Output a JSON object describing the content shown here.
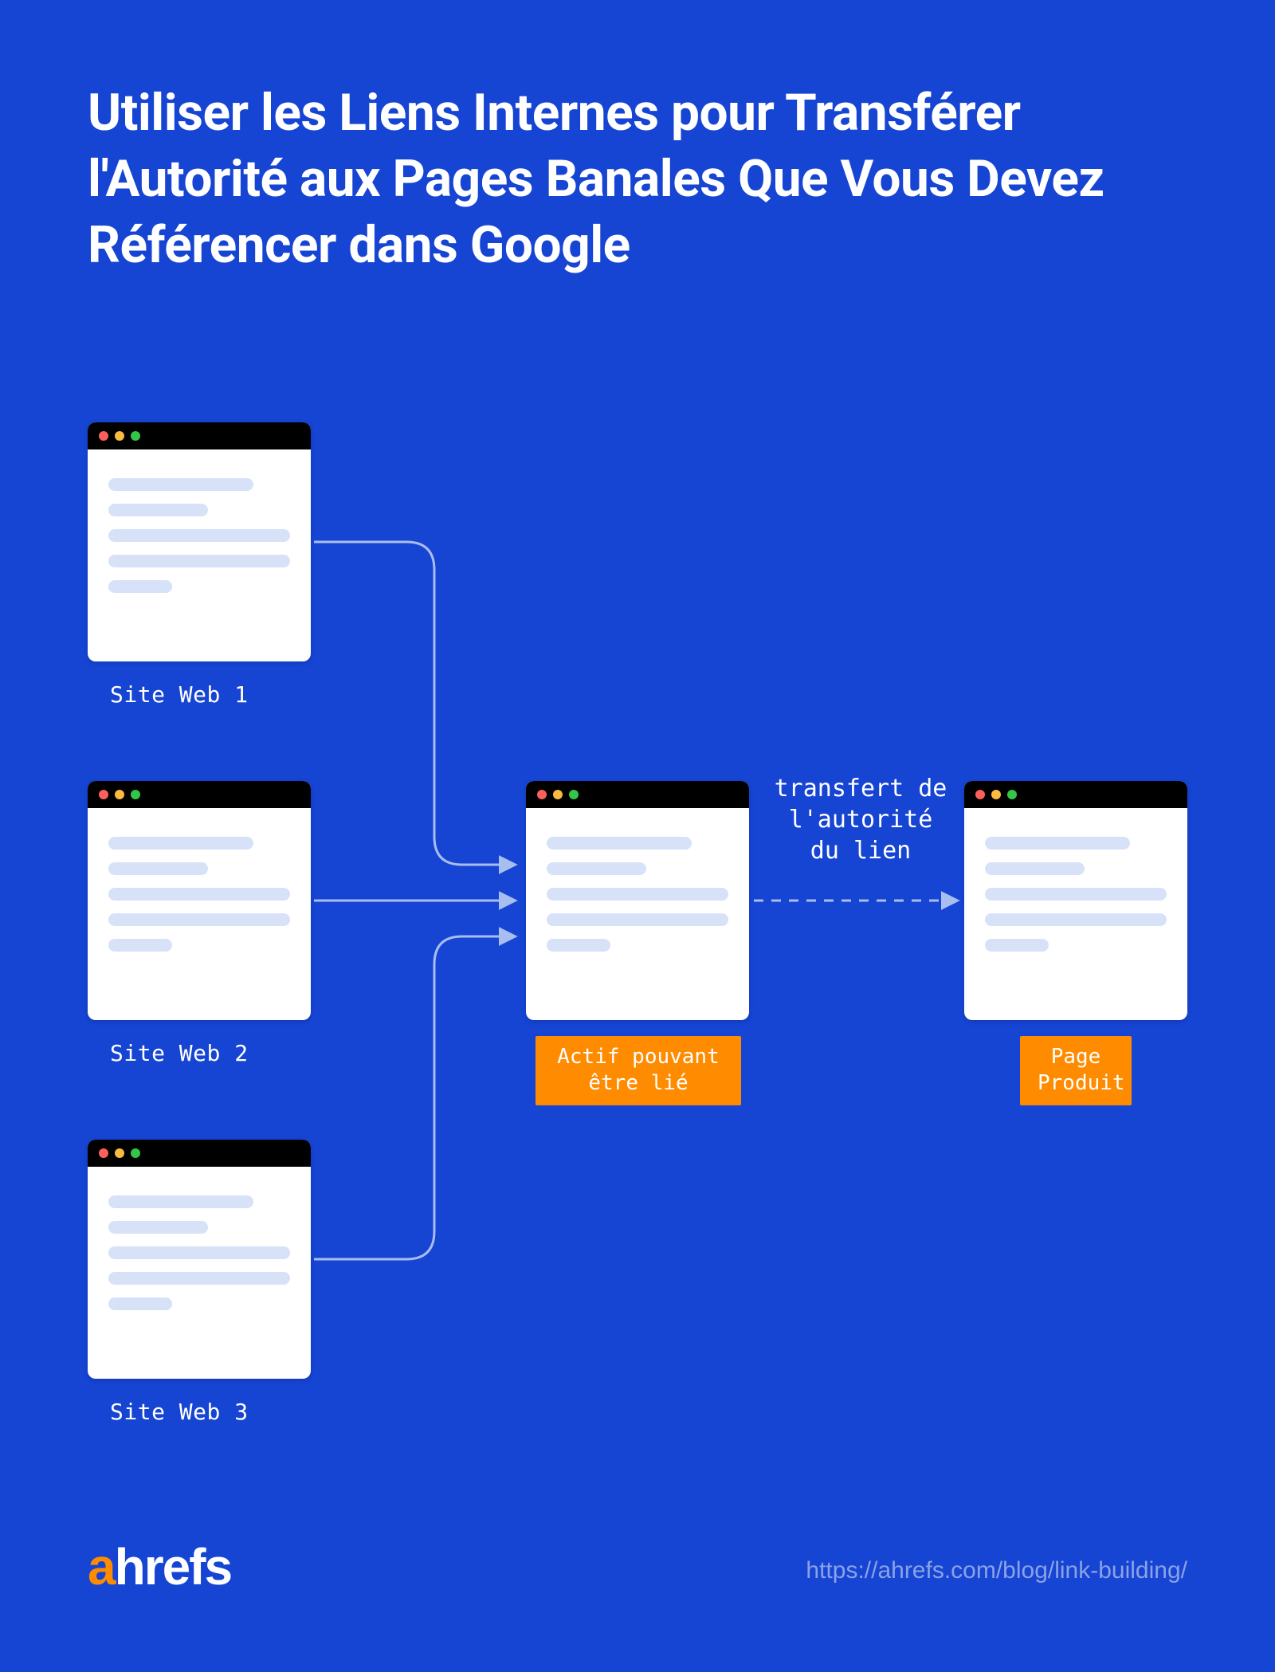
{
  "title": "Utiliser les Liens Internes pour Transférer l'Autorité aux Pages Banales Que Vous Devez Référencer dans Google",
  "sources": {
    "site1": "Site Web 1",
    "site2": "Site Web 2",
    "site3": "Site Web 3"
  },
  "badges": {
    "linkable_asset": "Actif pouvant\nêtre lié",
    "product_page": "Page\nProduit"
  },
  "transfer_label": "transfert de\nl'autorité\ndu lien",
  "footer": {
    "brand_a": "a",
    "brand_rest": "hrefs",
    "url": "https://ahrefs.com/blog/link-building/"
  },
  "colors": {
    "bg": "#1644d3",
    "accent": "#ff8c00",
    "line": "#a8bdf0",
    "browser_line": "#d7e2f8"
  }
}
